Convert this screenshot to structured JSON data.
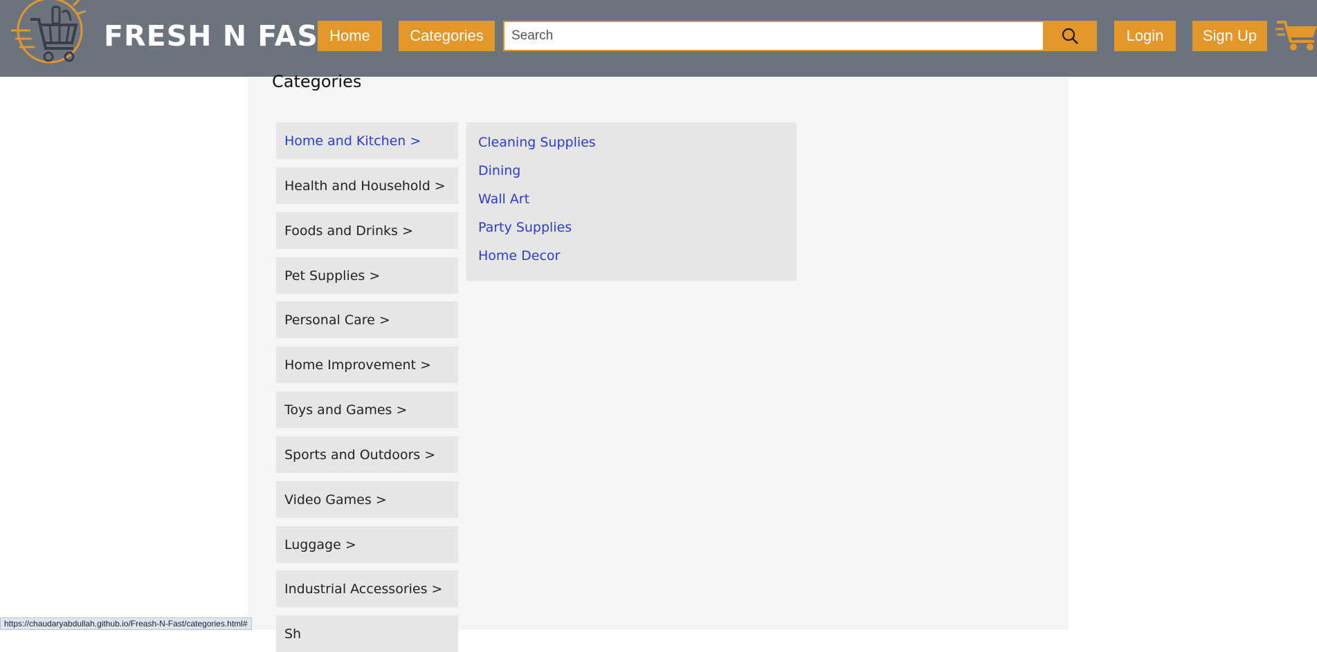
{
  "header": {
    "brand": "FRESH N FAST",
    "logo_icon": "shopping-basket-cart-icon",
    "nav": {
      "home_label": "Home",
      "categories_label": "Categories",
      "login_label": "Login",
      "signup_label": "Sign Up"
    },
    "search": {
      "placeholder": "Search",
      "value": "",
      "icon": "search-icon"
    },
    "cart_icon": "cart-icon"
  },
  "colors": {
    "navbar_bg": "#6b737f",
    "accent": "#e3962a",
    "link": "#2a3bd6",
    "panel_bg": "#e6e6e6",
    "page_bg": "#f5f5f5"
  },
  "page": {
    "title": "Categories",
    "categories": [
      {
        "label": "Home and Kitchen >",
        "active": true
      },
      {
        "label": "Health and Household >",
        "active": false
      },
      {
        "label": "Foods and Drinks >",
        "active": false
      },
      {
        "label": "Pet Supplies >",
        "active": false
      },
      {
        "label": "Personal Care >",
        "active": false
      },
      {
        "label": "Home Improvement >",
        "active": false
      },
      {
        "label": "Toys and Games >",
        "active": false
      },
      {
        "label": "Sports and Outdoors >",
        "active": false
      },
      {
        "label": "Video Games >",
        "active": false
      },
      {
        "label": "Luggage >",
        "active": false
      },
      {
        "label": "Industrial Accessories >",
        "active": false
      },
      {
        "label": "Sh",
        "active": false
      }
    ],
    "subcategories": [
      "Cleaning Supplies",
      "Dining",
      "Wall Art",
      "Party Supplies",
      "Home Decor"
    ]
  },
  "status_bar": {
    "url": "https://chaudaryabdullah.github.io/Freash-N-Fast/categories.html#"
  }
}
